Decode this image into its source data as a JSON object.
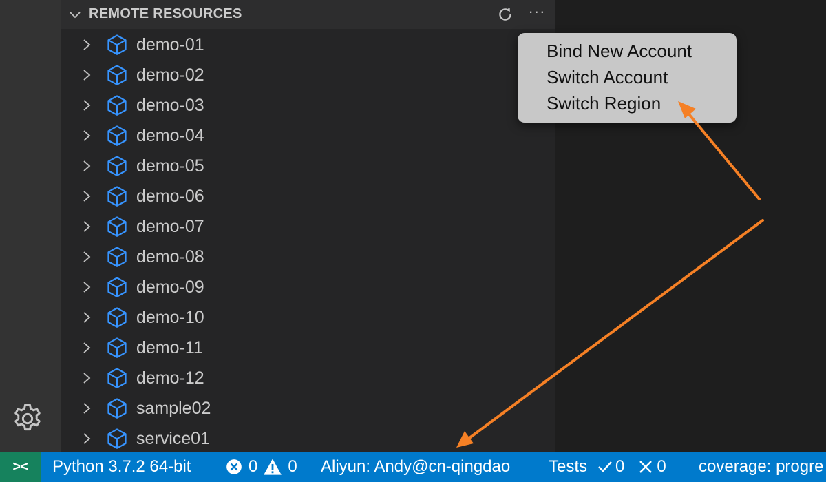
{
  "sidebar": {
    "section_title": "REMOTE RESOURCES",
    "tree_items": [
      {
        "label": "demo-01"
      },
      {
        "label": "demo-02"
      },
      {
        "label": "demo-03"
      },
      {
        "label": "demo-04"
      },
      {
        "label": "demo-05"
      },
      {
        "label": "demo-06"
      },
      {
        "label": "demo-07"
      },
      {
        "label": "demo-08"
      },
      {
        "label": "demo-09"
      },
      {
        "label": "demo-10"
      },
      {
        "label": "demo-11"
      },
      {
        "label": "demo-12"
      },
      {
        "label": "sample02"
      },
      {
        "label": "service01"
      }
    ]
  },
  "context_menu": {
    "items": [
      "Bind New Account",
      "Switch Account",
      "Switch Region"
    ]
  },
  "status_bar": {
    "remote_icon": "remote-icon",
    "python": "Python 3.7.2 64-bit",
    "errors": "0",
    "warnings": "0",
    "account": "Aliyun: Andy@cn-qingdao",
    "tests_label": "Tests",
    "tests_passed": "0",
    "tests_failed": "0",
    "coverage": "coverage: progre"
  },
  "colors": {
    "status_bar": "#007acc",
    "remote_button": "#16825d",
    "cube_icon": "#3794ff",
    "annotation_arrow": "#f58025"
  }
}
